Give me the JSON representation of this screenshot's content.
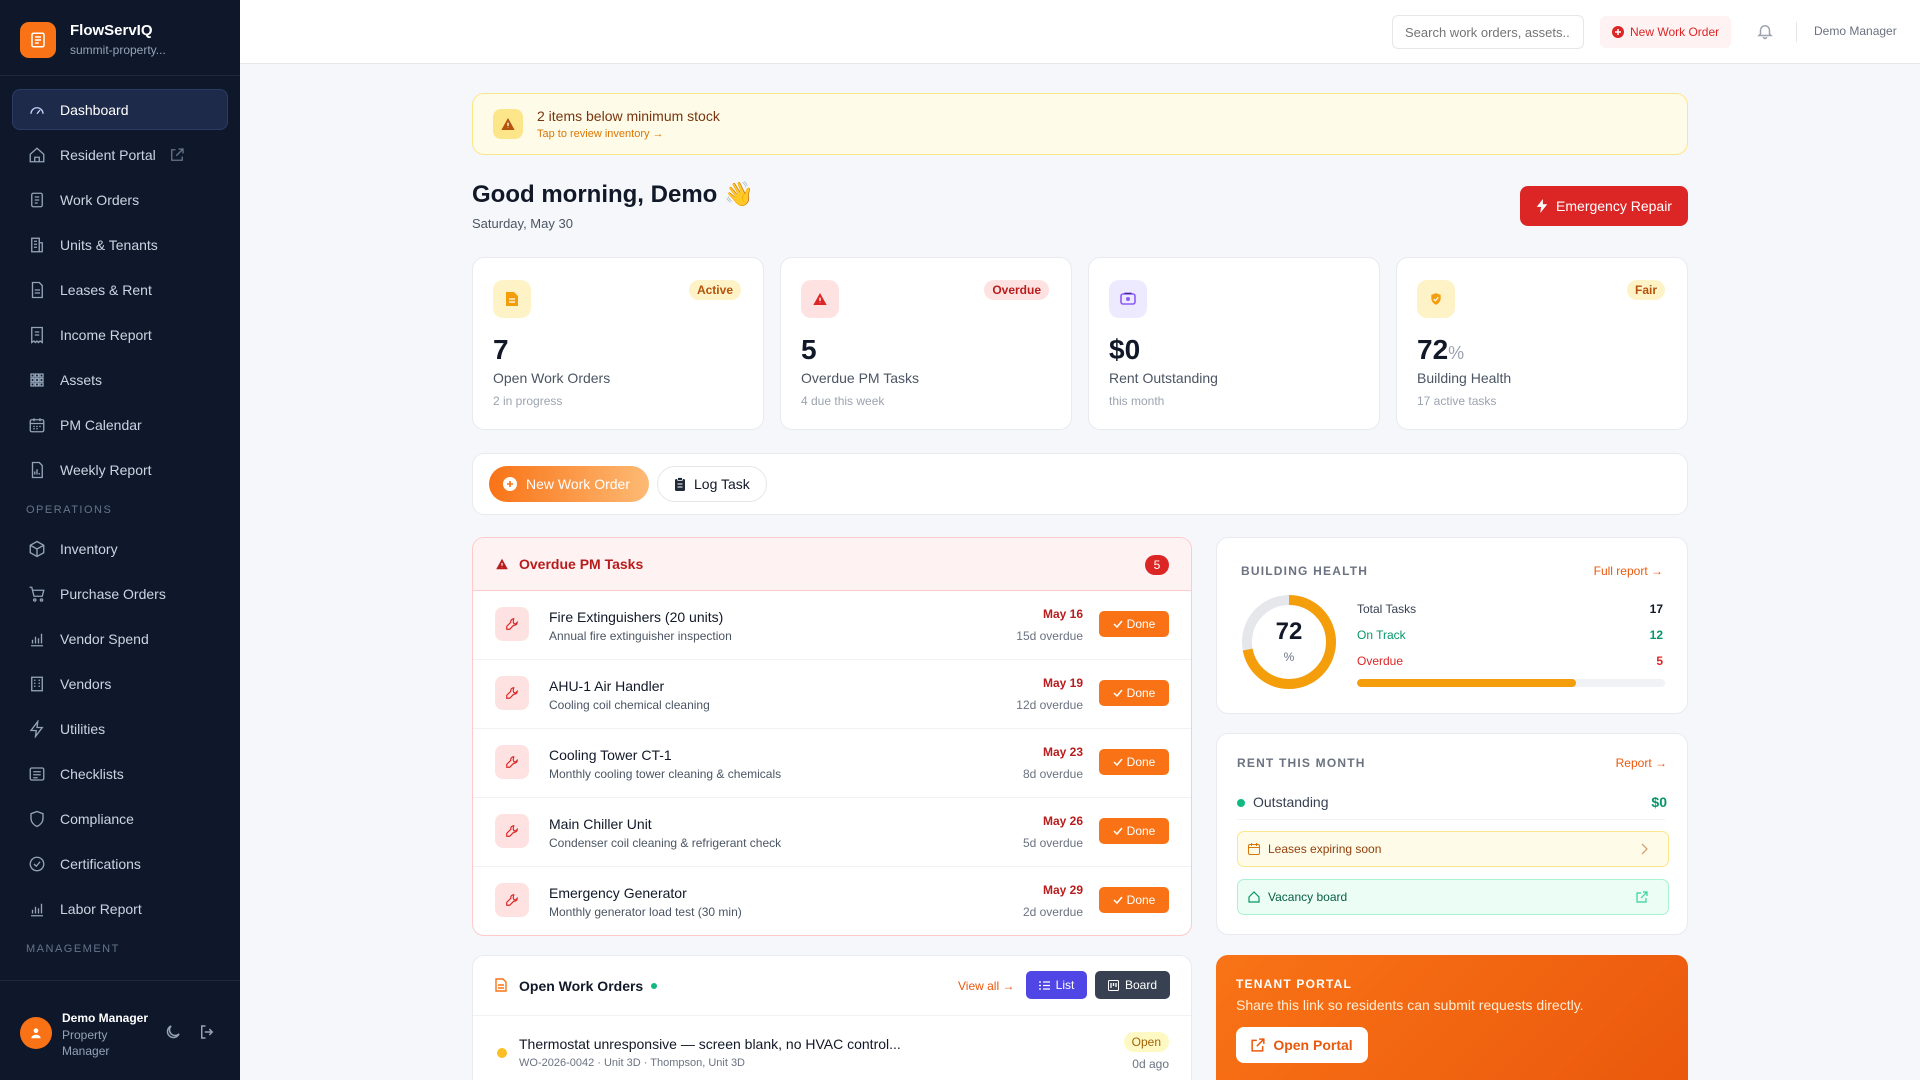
{
  "brand": {
    "name": "FlowServIQ",
    "subtitle": "summit-property..."
  },
  "sidebar": {
    "items": [
      {
        "label": "Dashboard",
        "icon": "gauge-icon",
        "active": true
      },
      {
        "label": "Resident Portal",
        "icon": "home-icon",
        "external": true
      },
      {
        "label": "Work Orders",
        "icon": "clipboard-icon"
      },
      {
        "label": "Units & Tenants",
        "icon": "building-icon"
      },
      {
        "label": "Leases & Rent",
        "icon": "document-icon"
      },
      {
        "label": "Income Report",
        "icon": "receipt-icon"
      },
      {
        "label": "Assets",
        "icon": "grid-icon"
      },
      {
        "label": "PM Calendar",
        "icon": "calendar-icon"
      },
      {
        "label": "Weekly Report",
        "icon": "report-icon"
      }
    ],
    "operations_label": "OPERATIONS",
    "operations": [
      {
        "label": "Inventory",
        "icon": "box-icon"
      },
      {
        "label": "Purchase Orders",
        "icon": "cart-icon"
      },
      {
        "label": "Vendor Spend",
        "icon": "bar-chart-icon"
      },
      {
        "label": "Vendors",
        "icon": "store-icon"
      },
      {
        "label": "Utilities",
        "icon": "bolt-icon"
      },
      {
        "label": "Checklists",
        "icon": "list-icon"
      },
      {
        "label": "Compliance",
        "icon": "shield-icon"
      },
      {
        "label": "Certifications",
        "icon": "badge-check-icon"
      },
      {
        "label": "Labor Report",
        "icon": "bar-chart-icon"
      }
    ],
    "management_label": "MANAGEMENT",
    "user": {
      "name": "Demo Manager",
      "role": "Property Manager"
    }
  },
  "topbar": {
    "search_placeholder": "Search work orders, assets...",
    "new_work_order": "New Work Order",
    "user": "Demo Manager"
  },
  "alert": {
    "title": "2 items below minimum stock",
    "subtitle": "Tap to review inventory →"
  },
  "greeting": {
    "text": "Good morning, Demo 👋",
    "date": "Saturday, May 30"
  },
  "emergency_button": "Emergency Repair",
  "stats": [
    {
      "value": "7",
      "unit": "",
      "label": "Open Work Orders",
      "sub": "2 in progress",
      "badge": "Active",
      "icon": "document-icon",
      "color": "#f59e0b"
    },
    {
      "value": "5",
      "unit": "",
      "label": "Overdue PM Tasks",
      "sub": "4 due this week",
      "badge": "Overdue",
      "icon": "warning-icon",
      "color": "#dc2626"
    },
    {
      "value": "$0",
      "unit": "",
      "label": "Rent Outstanding",
      "sub": "this month",
      "badge": "",
      "icon": "cash-icon",
      "color": "#8b5cf6"
    },
    {
      "value": "72",
      "unit": "%",
      "label": "Building Health",
      "sub": "17 active tasks",
      "badge": "Fair",
      "icon": "shield-icon",
      "color": "#f59e0b"
    }
  ],
  "quick_actions": {
    "new_work_order": "New Work Order",
    "log_task": "Log Task"
  },
  "overdue": {
    "title": "Overdue PM Tasks",
    "count": "5",
    "done_label": "Done",
    "rows": [
      {
        "name": "Fire Extinguishers (20 units)",
        "desc": "Annual fire extinguisher inspection",
        "date": "May 16",
        "overdue": "15d overdue"
      },
      {
        "name": "AHU-1 Air Handler",
        "desc": "Cooling coil chemical cleaning",
        "date": "May 19",
        "overdue": "12d overdue"
      },
      {
        "name": "Cooling Tower CT-1",
        "desc": "Monthly cooling tower cleaning & chemicals",
        "date": "May 23",
        "overdue": "8d overdue"
      },
      {
        "name": "Main Chiller Unit",
        "desc": "Condenser coil cleaning & refrigerant check",
        "date": "May 26",
        "overdue": "5d overdue"
      },
      {
        "name": "Emergency Generator",
        "desc": "Monthly generator load test (30 min)",
        "date": "May 29",
        "overdue": "2d overdue"
      }
    ]
  },
  "open_work_orders": {
    "title": "Open Work Orders",
    "view_all": "View all →",
    "list": "List",
    "board": "Board",
    "rows": [
      {
        "title": "Thermostat unresponsive — screen blank, no HVAC control...",
        "sub": "WO-2026-0042 · Unit 3D · Thompson, Unit 3D",
        "status": "Open",
        "age": "0d ago"
      }
    ]
  },
  "building_health": {
    "title": "BUILDING HEALTH",
    "link": "Full report →",
    "score": "72",
    "score_unit": "%",
    "score_fraction": 0.72,
    "total_label": "Total Tasks",
    "total": "17",
    "ontrack_label": "On Track",
    "ontrack": "12",
    "overdue_label": "Overdue",
    "overdue": "5",
    "progress_fraction": 0.71,
    "colors": {
      "ring": "#f59e0b",
      "ontrack": "#059669",
      "overdue": "#dc2626"
    }
  },
  "rent": {
    "title": "RENT THIS MONTH",
    "link": "Report →",
    "outstanding_label": "Outstanding",
    "outstanding": "$0",
    "leases": "Leases expiring soon",
    "vacancy": "Vacancy board"
  },
  "tenant_portal": {
    "title": "TENANT PORTAL",
    "subtitle": "Share this link so residents can submit requests directly.",
    "button": "Open Portal"
  }
}
